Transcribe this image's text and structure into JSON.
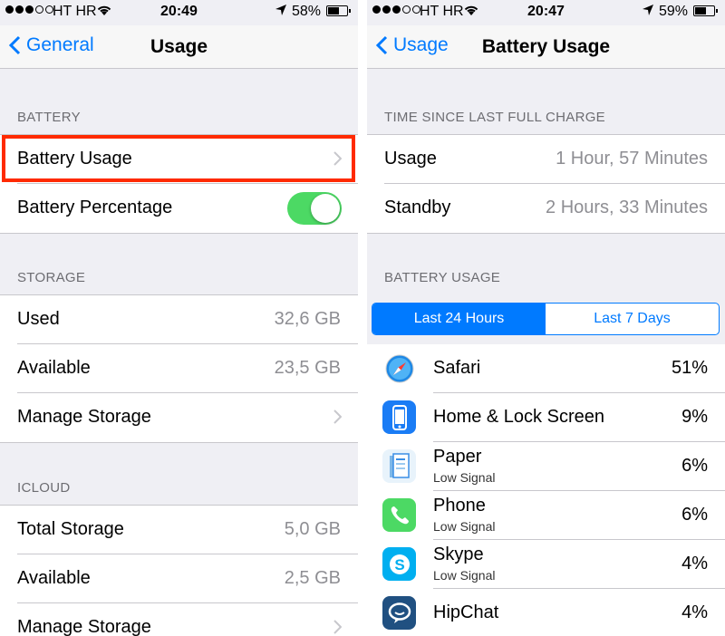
{
  "left": {
    "status": {
      "carrier": "HT HR",
      "time": "20:49",
      "battery_pct": "58%",
      "battery_level": 0.58
    },
    "nav": {
      "back_label": "General",
      "title": "Usage"
    },
    "battery_section": {
      "header": "BATTERY",
      "usage_label": "Battery Usage",
      "percentage_label": "Battery Percentage",
      "percentage_on": true
    },
    "storage_section": {
      "header": "STORAGE",
      "used_label": "Used",
      "used_value": "32,6 GB",
      "available_label": "Available",
      "available_value": "23,5 GB",
      "manage_label": "Manage Storage"
    },
    "icloud_section": {
      "header": "ICLOUD",
      "total_label": "Total Storage",
      "total_value": "5,0 GB",
      "available_label": "Available",
      "available_value": "2,5 GB",
      "manage_label": "Manage Storage"
    }
  },
  "right": {
    "status": {
      "carrier": "HT HR",
      "time": "20:47",
      "battery_pct": "59%",
      "battery_level": 0.59
    },
    "nav": {
      "back_label": "Usage",
      "title": "Battery Usage"
    },
    "charge_section": {
      "header": "TIME SINCE LAST FULL CHARGE",
      "usage_label": "Usage",
      "usage_value": "1 Hour, 57 Minutes",
      "standby_label": "Standby",
      "standby_value": "2 Hours, 33 Minutes"
    },
    "usage_section": {
      "header": "BATTERY USAGE",
      "seg_24h": "Last 24 Hours",
      "seg_7d": "Last 7 Days",
      "selected": "Last 24 Hours"
    },
    "apps": [
      {
        "name": "Safari",
        "sub": "",
        "pct": "51%",
        "icon": "safari-icon",
        "color": "#ffffff"
      },
      {
        "name": "Home & Lock Screen",
        "sub": "",
        "pct": "9%",
        "icon": "phone-screen-icon",
        "color": "#1a7cf5"
      },
      {
        "name": "Paper",
        "sub": "Low Signal",
        "pct": "6%",
        "icon": "paper-icon",
        "color": "#e8f3fb"
      },
      {
        "name": "Phone",
        "sub": "Low Signal",
        "pct": "6%",
        "icon": "phone-icon",
        "color": "#4cd964"
      },
      {
        "name": "Skype",
        "sub": "Low Signal",
        "pct": "4%",
        "icon": "skype-icon",
        "color": "#00aff0"
      },
      {
        "name": "HipChat",
        "sub": "",
        "pct": "4%",
        "icon": "hipchat-icon",
        "color": "#205081"
      }
    ]
  }
}
